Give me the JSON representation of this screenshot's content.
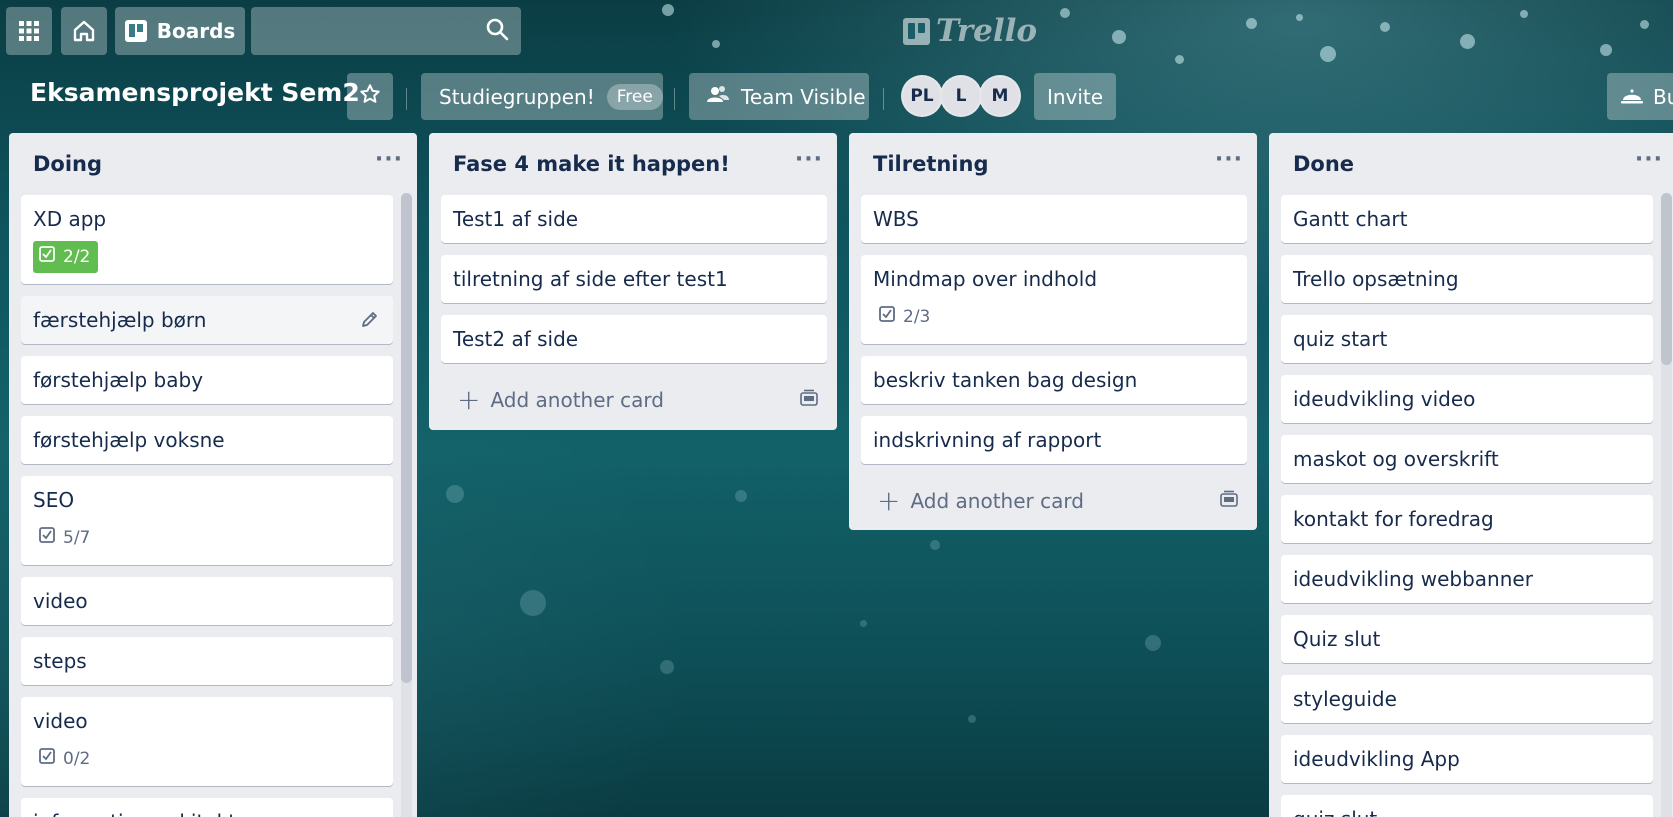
{
  "header": {
    "apps_icon": "grid-icon",
    "home_icon": "home-icon",
    "boards_label": "Boards",
    "search_value": "",
    "search_icon": "search-icon",
    "logo_text": "Trello"
  },
  "board": {
    "title": "Eksamensprojekt Sem2",
    "team_name": "Studiegruppen!",
    "team_badge": "Free",
    "visibility": "Team Visible",
    "members": [
      "PL",
      "L",
      "M"
    ],
    "invite_label": "Invite",
    "butler_partial": "Bu"
  },
  "lists": [
    {
      "title": "Doing",
      "cards": [
        {
          "title": "XD app",
          "checklist": "2/2",
          "complete": true
        },
        {
          "title": "færstehjælp børn",
          "hover": true
        },
        {
          "title": "førstehjælp baby"
        },
        {
          "title": "førstehjælp voksne"
        },
        {
          "title": "SEO",
          "checklist": "5/7"
        },
        {
          "title": "video"
        },
        {
          "title": "steps"
        },
        {
          "title": "video",
          "checklist": "0/2"
        },
        {
          "title": "informationsarkitektur"
        }
      ]
    },
    {
      "title": "Fase 4 make it happen!",
      "cards": [
        {
          "title": "Test1 af side"
        },
        {
          "title": "tilretning af side efter test1"
        },
        {
          "title": "Test2 af side"
        }
      ],
      "add_label": "Add another card"
    },
    {
      "title": "Tilretning",
      "cards": [
        {
          "title": "WBS"
        },
        {
          "title": "Mindmap over indhold",
          "checklist": "2/3"
        },
        {
          "title": "beskriv tanken bag design"
        },
        {
          "title": "indskrivning af rapport"
        }
      ],
      "add_label": "Add another card"
    },
    {
      "title": "Done",
      "cards": [
        {
          "title": "Gantt chart"
        },
        {
          "title": "Trello opsætning"
        },
        {
          "title": "quiz start"
        },
        {
          "title": "ideudvikling video"
        },
        {
          "title": "maskot og overskrift"
        },
        {
          "title": "kontakt for foredrag"
        },
        {
          "title": "ideudvikling webbanner"
        },
        {
          "title": "Quiz slut"
        },
        {
          "title": "styleguide"
        },
        {
          "title": "ideudvikling App"
        },
        {
          "title": "quiz slut"
        }
      ]
    }
  ],
  "colors": {
    "list_bg": "#ebecf0",
    "card_bg": "#ffffff",
    "text": "#172b4d",
    "muted": "#5e6c84",
    "complete_green": "#61bd4f"
  }
}
